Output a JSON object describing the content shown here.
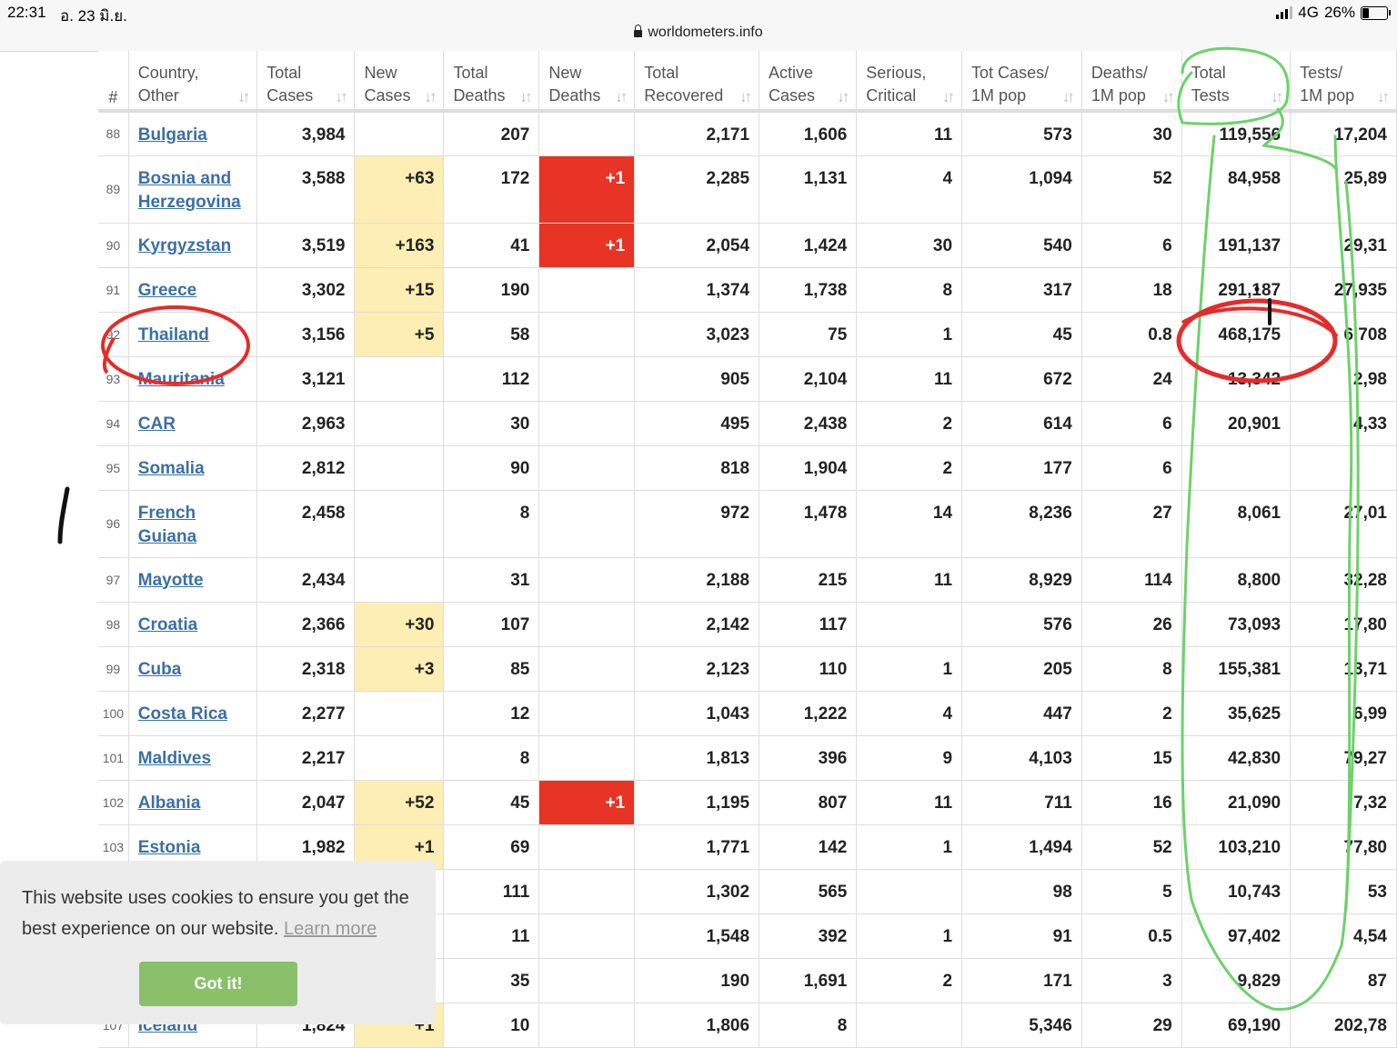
{
  "status_bar": {
    "time": "22:31",
    "date": "อ. 23 มิ.ย.",
    "network": "4G",
    "battery": "26%",
    "battery_level": 0.26
  },
  "browser": {
    "url": "worldometers.info"
  },
  "table": {
    "columns": [
      {
        "key": "rank",
        "lines": [
          "#",
          ""
        ]
      },
      {
        "key": "country",
        "lines": [
          "Country,",
          "Other"
        ]
      },
      {
        "key": "total_cases",
        "lines": [
          "Total",
          "Cases"
        ]
      },
      {
        "key": "new_cases",
        "lines": [
          "New",
          "Cases"
        ]
      },
      {
        "key": "total_deaths",
        "lines": [
          "Total",
          "Deaths"
        ]
      },
      {
        "key": "new_deaths",
        "lines": [
          "New",
          "Deaths"
        ]
      },
      {
        "key": "total_recovered",
        "lines": [
          "Total",
          "Recovered"
        ]
      },
      {
        "key": "active_cases",
        "lines": [
          "Active",
          "Cases"
        ]
      },
      {
        "key": "serious",
        "lines": [
          "Serious,",
          "Critical"
        ]
      },
      {
        "key": "cases_per_1m",
        "lines": [
          "Tot Cases/",
          "1M pop"
        ]
      },
      {
        "key": "deaths_per_1m",
        "lines": [
          "Deaths/",
          "1M pop"
        ]
      },
      {
        "key": "total_tests",
        "lines": [
          "Total",
          "Tests"
        ]
      },
      {
        "key": "tests_per_1m",
        "lines": [
          "Tests/",
          "1M pop"
        ]
      }
    ],
    "rows": [
      {
        "rank": "88",
        "country": [
          "Bulgaria"
        ],
        "total_cases": "3,984",
        "new_cases": "",
        "total_deaths": "207",
        "new_deaths": "",
        "total_recovered": "2,171",
        "active_cases": "1,606",
        "serious": "11",
        "cases_per_1m": "573",
        "deaths_per_1m": "30",
        "total_tests": "119,556",
        "tests_per_1m": "17,204"
      },
      {
        "rank": "89",
        "country": [
          "Bosnia and",
          "Herzegovina"
        ],
        "total_cases": "3,588",
        "new_cases": "+63",
        "total_deaths": "172",
        "new_deaths": "+1",
        "total_recovered": "2,285",
        "active_cases": "1,131",
        "serious": "4",
        "cases_per_1m": "1,094",
        "deaths_per_1m": "52",
        "total_tests": "84,958",
        "tests_per_1m": "25,89"
      },
      {
        "rank": "90",
        "country": [
          "Kyrgyzstan"
        ],
        "total_cases": "3,519",
        "new_cases": "+163",
        "total_deaths": "41",
        "new_deaths": "+1",
        "total_recovered": "2,054",
        "active_cases": "1,424",
        "serious": "30",
        "cases_per_1m": "540",
        "deaths_per_1m": "6",
        "total_tests": "191,137",
        "tests_per_1m": "29,31"
      },
      {
        "rank": "91",
        "country": [
          "Greece"
        ],
        "total_cases": "3,302",
        "new_cases": "+15",
        "total_deaths": "190",
        "new_deaths": "",
        "total_recovered": "1,374",
        "active_cases": "1,738",
        "serious": "8",
        "cases_per_1m": "317",
        "deaths_per_1m": "18",
        "total_tests": "291,187",
        "tests_per_1m": "27,935"
      },
      {
        "rank": "92",
        "country": [
          "Thailand"
        ],
        "total_cases": "3,156",
        "new_cases": "+5",
        "total_deaths": "58",
        "new_deaths": "",
        "total_recovered": "3,023",
        "active_cases": "75",
        "serious": "1",
        "cases_per_1m": "45",
        "deaths_per_1m": "0.8",
        "total_tests": "468,175",
        "tests_per_1m": "6,708"
      },
      {
        "rank": "93",
        "country": [
          "Mauritania"
        ],
        "total_cases": "3,121",
        "new_cases": "",
        "total_deaths": "112",
        "new_deaths": "",
        "total_recovered": "905",
        "active_cases": "2,104",
        "serious": "11",
        "cases_per_1m": "672",
        "deaths_per_1m": "24",
        "total_tests": "13,342",
        "tests_per_1m": "2,98"
      },
      {
        "rank": "94",
        "country": [
          "CAR"
        ],
        "total_cases": "2,963",
        "new_cases": "",
        "total_deaths": "30",
        "new_deaths": "",
        "total_recovered": "495",
        "active_cases": "2,438",
        "serious": "2",
        "cases_per_1m": "614",
        "deaths_per_1m": "6",
        "total_tests": "20,901",
        "tests_per_1m": "4,33"
      },
      {
        "rank": "95",
        "country": [
          "Somalia"
        ],
        "total_cases": "2,812",
        "new_cases": "",
        "total_deaths": "90",
        "new_deaths": "",
        "total_recovered": "818",
        "active_cases": "1,904",
        "serious": "2",
        "cases_per_1m": "177",
        "deaths_per_1m": "6",
        "total_tests": "",
        "tests_per_1m": ""
      },
      {
        "rank": "96",
        "country": [
          "French",
          "Guiana"
        ],
        "total_cases": "2,458",
        "new_cases": "",
        "total_deaths": "8",
        "new_deaths": "",
        "total_recovered": "972",
        "active_cases": "1,478",
        "serious": "14",
        "cases_per_1m": "8,236",
        "deaths_per_1m": "27",
        "total_tests": "8,061",
        "tests_per_1m": "27,01"
      },
      {
        "rank": "97",
        "country": [
          "Mayotte"
        ],
        "total_cases": "2,434",
        "new_cases": "",
        "total_deaths": "31",
        "new_deaths": "",
        "total_recovered": "2,188",
        "active_cases": "215",
        "serious": "11",
        "cases_per_1m": "8,929",
        "deaths_per_1m": "114",
        "total_tests": "8,800",
        "tests_per_1m": "32,28"
      },
      {
        "rank": "98",
        "country": [
          "Croatia"
        ],
        "total_cases": "2,366",
        "new_cases": "+30",
        "total_deaths": "107",
        "new_deaths": "",
        "total_recovered": "2,142",
        "active_cases": "117",
        "serious": "",
        "cases_per_1m": "576",
        "deaths_per_1m": "26",
        "total_tests": "73,093",
        "tests_per_1m": "17,80"
      },
      {
        "rank": "99",
        "country": [
          "Cuba"
        ],
        "total_cases": "2,318",
        "new_cases": "+3",
        "total_deaths": "85",
        "new_deaths": "",
        "total_recovered": "2,123",
        "active_cases": "110",
        "serious": "1",
        "cases_per_1m": "205",
        "deaths_per_1m": "8",
        "total_tests": "155,381",
        "tests_per_1m": "13,71"
      },
      {
        "rank": "100",
        "country": [
          "Costa Rica"
        ],
        "total_cases": "2,277",
        "new_cases": "",
        "total_deaths": "12",
        "new_deaths": "",
        "total_recovered": "1,043",
        "active_cases": "1,222",
        "serious": "4",
        "cases_per_1m": "447",
        "deaths_per_1m": "2",
        "total_tests": "35,625",
        "tests_per_1m": "6,99"
      },
      {
        "rank": "101",
        "country": [
          "Maldives"
        ],
        "total_cases": "2,217",
        "new_cases": "",
        "total_deaths": "8",
        "new_deaths": "",
        "total_recovered": "1,813",
        "active_cases": "396",
        "serious": "9",
        "cases_per_1m": "4,103",
        "deaths_per_1m": "15",
        "total_tests": "42,830",
        "tests_per_1m": "79,27"
      },
      {
        "rank": "102",
        "country": [
          "Albania"
        ],
        "total_cases": "2,047",
        "new_cases": "+52",
        "total_deaths": "45",
        "new_deaths": "+1",
        "total_recovered": "1,195",
        "active_cases": "807",
        "serious": "11",
        "cases_per_1m": "711",
        "deaths_per_1m": "16",
        "total_tests": "21,090",
        "tests_per_1m": "7,32"
      },
      {
        "rank": "103",
        "country": [
          "Estonia"
        ],
        "total_cases": "1,982",
        "new_cases": "+1",
        "total_deaths": "69",
        "new_deaths": "",
        "total_recovered": "1,771",
        "active_cases": "142",
        "serious": "1",
        "cases_per_1m": "1,494",
        "deaths_per_1m": "52",
        "total_tests": "103,210",
        "tests_per_1m": "77,80"
      },
      {
        "rank": "",
        "country": [
          ""
        ],
        "total_cases": "",
        "new_cases": "",
        "total_deaths": "111",
        "new_deaths": "",
        "total_recovered": "1,302",
        "active_cases": "565",
        "serious": "",
        "cases_per_1m": "98",
        "deaths_per_1m": "5",
        "total_tests": "10,743",
        "tests_per_1m": "53"
      },
      {
        "rank": "",
        "country": [
          ""
        ],
        "total_cases": "",
        "new_cases": "",
        "total_deaths": "11",
        "new_deaths": "",
        "total_recovered": "1,548",
        "active_cases": "392",
        "serious": "1",
        "cases_per_1m": "91",
        "deaths_per_1m": "0.5",
        "total_tests": "97,402",
        "tests_per_1m": "4,54"
      },
      {
        "rank": "",
        "country": [
          ""
        ],
        "total_cases": "",
        "new_cases": "",
        "total_deaths": "35",
        "new_deaths": "",
        "total_recovered": "190",
        "active_cases": "1,691",
        "serious": "2",
        "cases_per_1m": "171",
        "deaths_per_1m": "3",
        "total_tests": "9,829",
        "tests_per_1m": "87"
      },
      {
        "rank": "107",
        "country": [
          "Iceland"
        ],
        "total_cases": "1,824",
        "new_cases": "+1",
        "total_deaths": "10",
        "new_deaths": "",
        "total_recovered": "1,806",
        "active_cases": "8",
        "serious": "",
        "cases_per_1m": "5,346",
        "deaths_per_1m": "29",
        "total_tests": "69,190",
        "tests_per_1m": "202,78"
      }
    ]
  },
  "cookie_banner": {
    "message": "This website uses cookies to ensure you get the best experience on our website.",
    "learn_more": "Learn more",
    "button": "Got it!"
  },
  "colors": {
    "new_cases_highlight": "#fdeeb3",
    "new_deaths_highlight": "#e83424",
    "link": "#3a6fa8",
    "cookie_button": "#8ac06a",
    "annotation_green": "#6dd16a",
    "annotation_red": "#e52b2b"
  }
}
